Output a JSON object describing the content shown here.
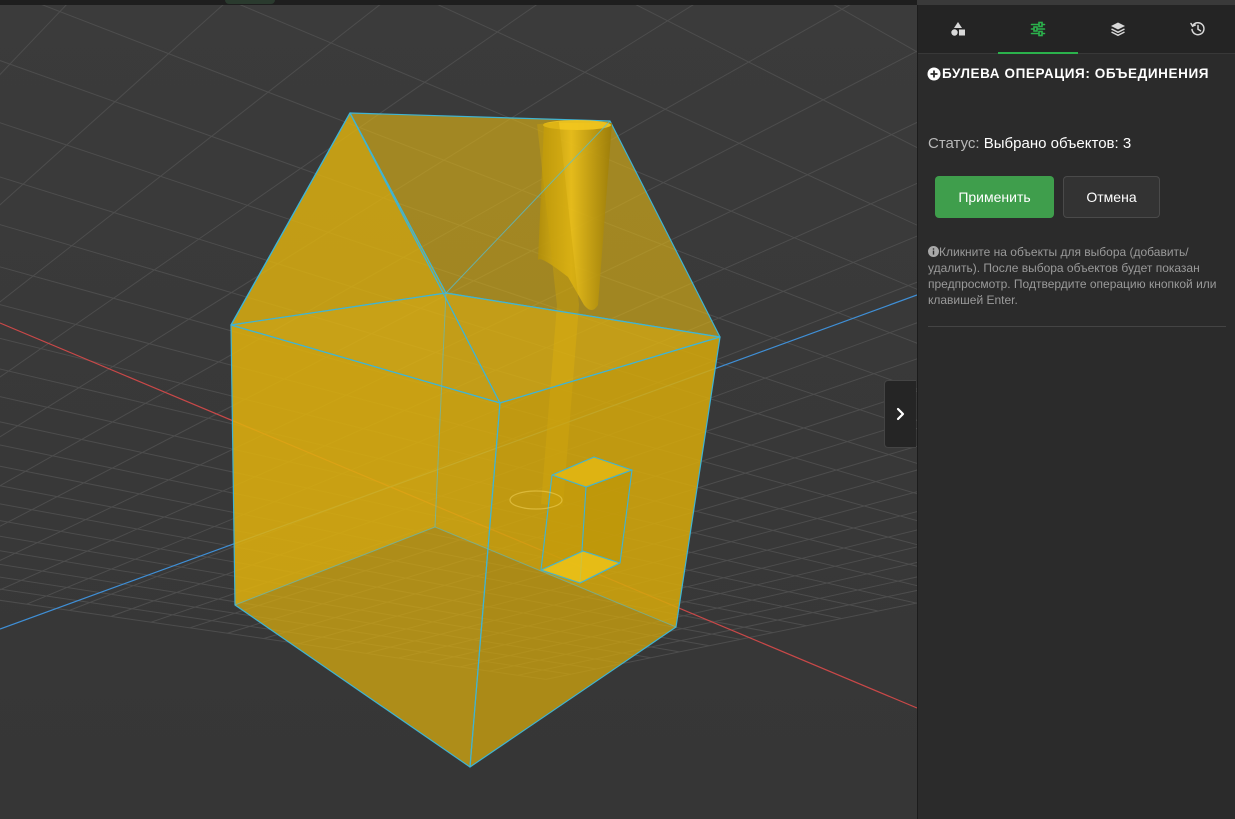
{
  "tabs": [
    {
      "icon": "shapes-icon",
      "active": false
    },
    {
      "icon": "sliders-icon",
      "active": true
    },
    {
      "icon": "layers-icon",
      "active": false
    },
    {
      "icon": "history-icon",
      "active": false
    }
  ],
  "operation": {
    "title": "БУЛЕВА ОПЕРАЦИЯ: ОБЪЕДИНЕНИЯ",
    "status_label": "Статус:",
    "status_value": "Выбрано объектов: 3",
    "apply_label": "Применить",
    "cancel_label": "Отмена",
    "hint": "Кликните на объекты для выбора (добавить/удалить). После выбора объектов будет показан предпросмотр. Подтвердите операцию кнопкой или клавишей Enter."
  },
  "colors": {
    "accent": "#2bb24c",
    "apply": "#3f9e4c",
    "object_fill": "#e3b50f",
    "object_edge": "#3fb4d4",
    "axis_x": "#d64545",
    "axis_z": "#3f8fd6"
  }
}
